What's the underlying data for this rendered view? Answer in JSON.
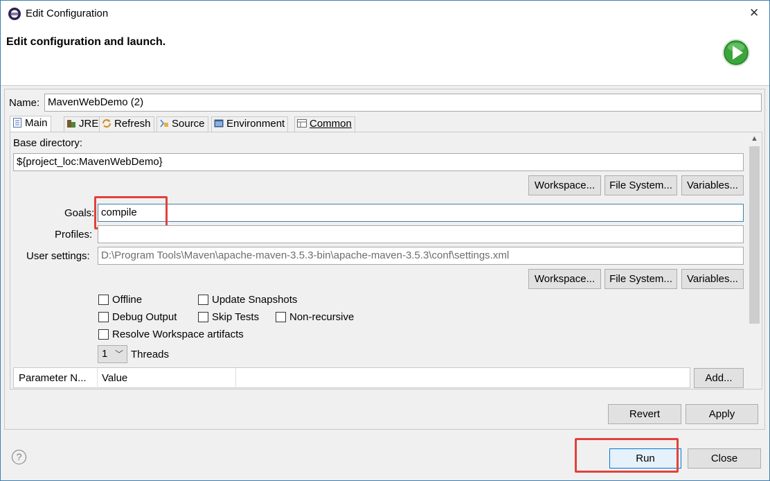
{
  "window": {
    "title": "Edit Configuration",
    "close_glyph": "✕"
  },
  "banner": {
    "heading": "Edit configuration and launch."
  },
  "name_field": {
    "label": "Name:",
    "value": "MavenWebDemo (2)"
  },
  "tabs": [
    {
      "label": "Main",
      "icon": "main-tab-icon",
      "active": true
    },
    {
      "label": "JRE",
      "icon": "jre-icon"
    },
    {
      "label": "Refresh",
      "icon": "refresh-icon"
    },
    {
      "label": "Source",
      "icon": "source-icon"
    },
    {
      "label": "Environment",
      "icon": "environment-icon"
    },
    {
      "label": "Common",
      "icon": "common-icon"
    }
  ],
  "main": {
    "base_directory_label": "Base directory:",
    "base_directory_value": "${project_loc:MavenWebDemo}",
    "buttons_row1": {
      "workspace": "Workspace...",
      "file_system": "File System...",
      "variables": "Variables..."
    },
    "goals_label": "Goals:",
    "goals_value": "compile",
    "profiles_label": "Profiles:",
    "profiles_value": "",
    "user_settings_label": "User settings:",
    "user_settings_value": "D:\\Program Tools\\Maven\\apache-maven-3.5.3-bin\\apache-maven-3.5.3\\conf\\settings.xml",
    "buttons_row2": {
      "workspace": "Workspace...",
      "file_system": "File System...",
      "variables": "Variables..."
    },
    "checkboxes": {
      "offline": {
        "label": "Offline",
        "checked": false
      },
      "update_snapshots": {
        "label": "Update Snapshots",
        "checked": false
      },
      "debug_output": {
        "label": "Debug Output",
        "checked": false
      },
      "skip_tests": {
        "label": "Skip Tests",
        "checked": false
      },
      "non_recursive": {
        "label": "Non-recursive",
        "checked": false
      },
      "resolve_workspace": {
        "label": "Resolve Workspace artifacts",
        "checked": false
      }
    },
    "threads_value": "1",
    "threads_label": "Threads",
    "param_table": {
      "col_name": "Parameter N...",
      "col_value": "Value"
    },
    "add_button": "Add..."
  },
  "footer": {
    "revert": "Revert",
    "apply": "Apply",
    "run": "Run",
    "close": "Close",
    "help_glyph": "?"
  },
  "colors": {
    "highlight_box": "#e2413c",
    "run_icon_green": "#3aa53a",
    "window_border": "#3c7fb1"
  }
}
